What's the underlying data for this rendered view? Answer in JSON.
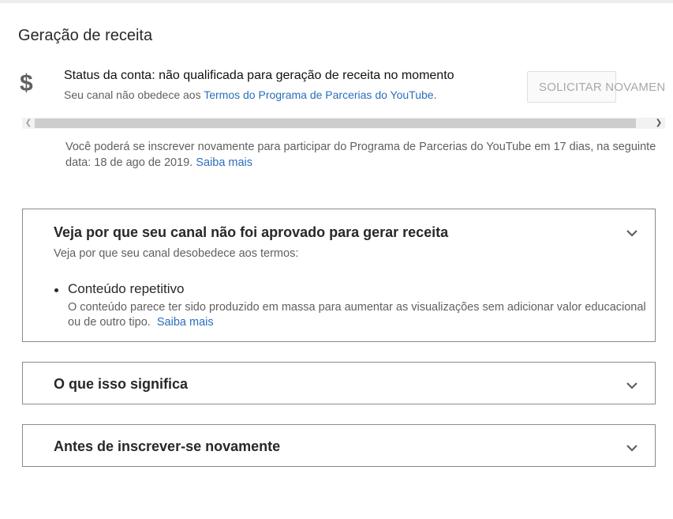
{
  "header": {
    "title": "Geração de receita"
  },
  "status": {
    "icon": "dollar-icon",
    "glyph": "$",
    "line": "Status da conta: não qualificada para geração de receita no momento",
    "sub_prefix": "Seu canal não obedece aos ",
    "sub_link": "Termos do Programa de Parcerias do YouTube",
    "sub_suffix": ".",
    "button_label": "SOLICITAR NOVAMEN"
  },
  "notice": {
    "text": "Você poderá se inscrever novamente para participar do Programa de Parcerias do YouTube em 17 dias, na seguinte data: 18 de ago de 2019.",
    "link": "Saiba mais"
  },
  "panels": [
    {
      "title": "Veja por que seu canal não foi aprovado para gerar receita",
      "subtitle": "Veja por que seu canal desobedece aos termos:",
      "items": [
        {
          "title": "Conteúdo repetitivo",
          "description": "O conteúdo parece ter sido produzido em massa para aumentar as visualizações sem adicionar valor educacional ou de outro tipo.",
          "link": "Saiba mais"
        }
      ]
    },
    {
      "title": "O que isso significa"
    },
    {
      "title": "Antes de inscrever-se novamente"
    }
  ],
  "colors": {
    "link": "#2a6ebd",
    "text": "#282828",
    "secondary": "#606060",
    "border": "#8a8a8a"
  }
}
